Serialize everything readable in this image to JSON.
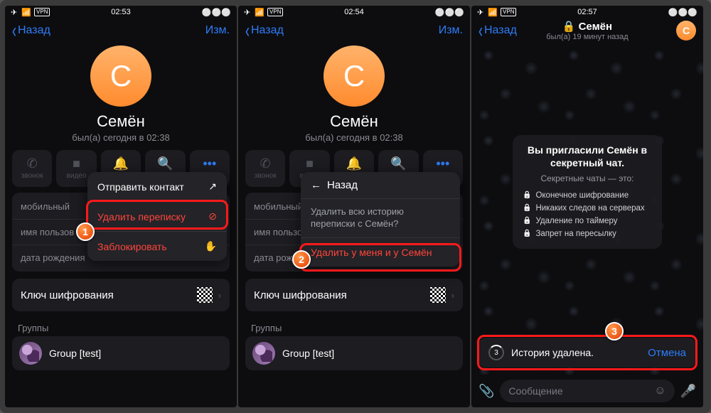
{
  "status": {
    "time1": "02:53",
    "time2": "02:54",
    "time3": "02:57",
    "vpn": "VPN"
  },
  "nav": {
    "back": "Назад",
    "edit": "Изм."
  },
  "profile": {
    "initial": "C",
    "name": "Семён",
    "seen": "был(а) сегодня в 02:38"
  },
  "actions": {
    "call": "звонок",
    "video": "видео",
    "mute": "звук",
    "search": "поиск",
    "more": "ещё"
  },
  "info": {
    "mobile": "мобильный",
    "username": "имя пользов",
    "username2": "имя пользов",
    "birthday": "дата рождения",
    "key": "Ключ шифрования"
  },
  "groups": {
    "title": "Группы",
    "item": "Group [test]"
  },
  "popup1": {
    "send": "Отправить контакт",
    "delete": "Удалить переписку",
    "block": "Заблокировать"
  },
  "popup2": {
    "back": "Назад",
    "question": "Удалить всю историю переписки с Семён?",
    "action": "Удалить у меня и у Семён"
  },
  "chat3": {
    "title": "Семён",
    "seen": "был(а) 19 минут назад",
    "secret_h1": "Вы пригласили Семён в секретный чат.",
    "secret_sub": "Секретные чаты — это:",
    "f1": "Оконечное шифрование",
    "f2": "Никаких следов на серверах",
    "f3": "Удаление по таймеру",
    "f4": "Запрет на пересылку",
    "toast": "История удалена.",
    "undo": "Отмена",
    "countdown": "3",
    "placeholder": "Сообщение"
  },
  "badges": {
    "b1": "1",
    "b2": "2",
    "b3": "3"
  }
}
